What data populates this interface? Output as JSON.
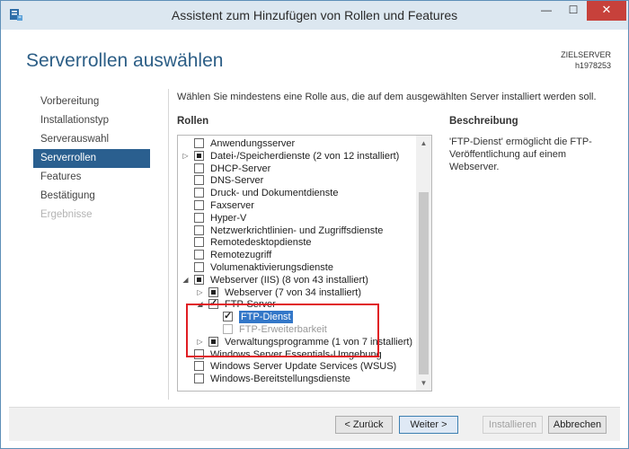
{
  "window": {
    "title": "Assistent zum Hinzufügen von Rollen und Features",
    "minimize_glyph": "—",
    "maximize_glyph": "☐",
    "close_glyph": "✕"
  },
  "page": {
    "title": "Serverrollen auswählen",
    "server_label": "ZIELSERVER",
    "server_name": "h1978253"
  },
  "nav": [
    {
      "label": "Vorbereitung",
      "state": "normal"
    },
    {
      "label": "Installationstyp",
      "state": "normal"
    },
    {
      "label": "Serverauswahl",
      "state": "normal"
    },
    {
      "label": "Serverrollen",
      "state": "active"
    },
    {
      "label": "Features",
      "state": "normal"
    },
    {
      "label": "Bestätigung",
      "state": "normal"
    },
    {
      "label": "Ergebnisse",
      "state": "disabled"
    }
  ],
  "main": {
    "instructions": "Wählen Sie mindestens eine Rolle aus, die auf dem ausgewählten Server installiert werden soll.",
    "roles_heading": "Rollen",
    "description_heading": "Beschreibung",
    "description_text": "'FTP-Dienst' ermöglicht die FTP-Veröffentlichung auf einem Webserver."
  },
  "roles": [
    {
      "label": "Anwendungsserver",
      "state": "unchecked",
      "level": 0,
      "expander": ""
    },
    {
      "label": "Datei-/Speicherdienste (2 von 12 installiert)",
      "state": "partial",
      "level": 0,
      "expander": "collapsed"
    },
    {
      "label": "DHCP-Server",
      "state": "unchecked",
      "level": 0,
      "expander": ""
    },
    {
      "label": "DNS-Server",
      "state": "unchecked",
      "level": 0,
      "expander": ""
    },
    {
      "label": "Druck- und Dokumentdienste",
      "state": "unchecked",
      "level": 0,
      "expander": ""
    },
    {
      "label": "Faxserver",
      "state": "unchecked",
      "level": 0,
      "expander": ""
    },
    {
      "label": "Hyper-V",
      "state": "unchecked",
      "level": 0,
      "expander": ""
    },
    {
      "label": "Netzwerkrichtlinien- und Zugriffsdienste",
      "state": "unchecked",
      "level": 0,
      "expander": ""
    },
    {
      "label": "Remotedesktopdienste",
      "state": "unchecked",
      "level": 0,
      "expander": ""
    },
    {
      "label": "Remotezugriff",
      "state": "unchecked",
      "level": 0,
      "expander": ""
    },
    {
      "label": "Volumenaktivierungsdienste",
      "state": "unchecked",
      "level": 0,
      "expander": ""
    },
    {
      "label": "Webserver (IIS) (8 von 43 installiert)",
      "state": "partial",
      "level": 0,
      "expander": "expanded"
    },
    {
      "label": "Webserver (7 von 34 installiert)",
      "state": "partial",
      "level": 1,
      "expander": "collapsed"
    },
    {
      "label": "FTP-Server",
      "state": "checked",
      "level": 1,
      "expander": "expanded"
    },
    {
      "label": "FTP-Dienst",
      "state": "checked",
      "level": 2,
      "expander": "",
      "selected": true
    },
    {
      "label": "FTP-Erweiterbarkeit",
      "state": "unchecked",
      "level": 2,
      "expander": "",
      "disabled": true
    },
    {
      "label": "Verwaltungsprogramme (1 von 7 installiert)",
      "state": "partial",
      "level": 1,
      "expander": "collapsed"
    },
    {
      "label": "Windows Server Essentials-Umgebung",
      "state": "unchecked",
      "level": 0,
      "expander": ""
    },
    {
      "label": "Windows Server Update Services (WSUS)",
      "state": "unchecked",
      "level": 0,
      "expander": ""
    },
    {
      "label": "Windows-Bereitstellungsdienste",
      "state": "unchecked",
      "level": 0,
      "expander": ""
    }
  ],
  "buttons": {
    "back": "< Zurück",
    "next": "Weiter >",
    "install": "Installieren",
    "cancel": "Abbrechen"
  },
  "icons": {
    "app": "server-manager-icon",
    "scroll_up": "▲",
    "scroll_down": "▼",
    "expander_collapsed": "▷",
    "expander_expanded": "◢"
  }
}
